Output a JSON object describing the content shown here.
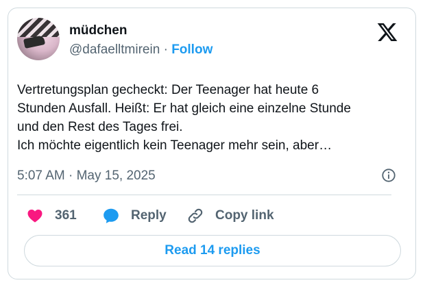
{
  "author": {
    "display_name": "müdchen",
    "handle": "@dafaelltmirein",
    "separator": "·",
    "follow_label": "Follow"
  },
  "tweet": {
    "text": "Vertretungsplan gecheckt: Der Teenager hat heute 6\nStunden Ausfall. Heißt: Er hat gleich eine einzelne Stunde\nund den Rest des Tages frei.\nIch möchte eigentlich kein Teenager mehr sein, aber…",
    "timestamp": "5:07 AM · May 15, 2025"
  },
  "actions": {
    "like_count": "361",
    "reply_label": "Reply",
    "copy_link_label": "Copy link"
  },
  "footer": {
    "read_replies_label": "Read 14 replies"
  },
  "icons": {
    "brand": "x-logo-icon",
    "info": "info-icon",
    "like": "heart-icon",
    "reply": "speech-bubble-icon",
    "copy": "link-icon"
  },
  "colors": {
    "accent": "#1d9bf0",
    "like": "#f91880",
    "muted_text": "#536471",
    "border": "#cfd9de"
  }
}
